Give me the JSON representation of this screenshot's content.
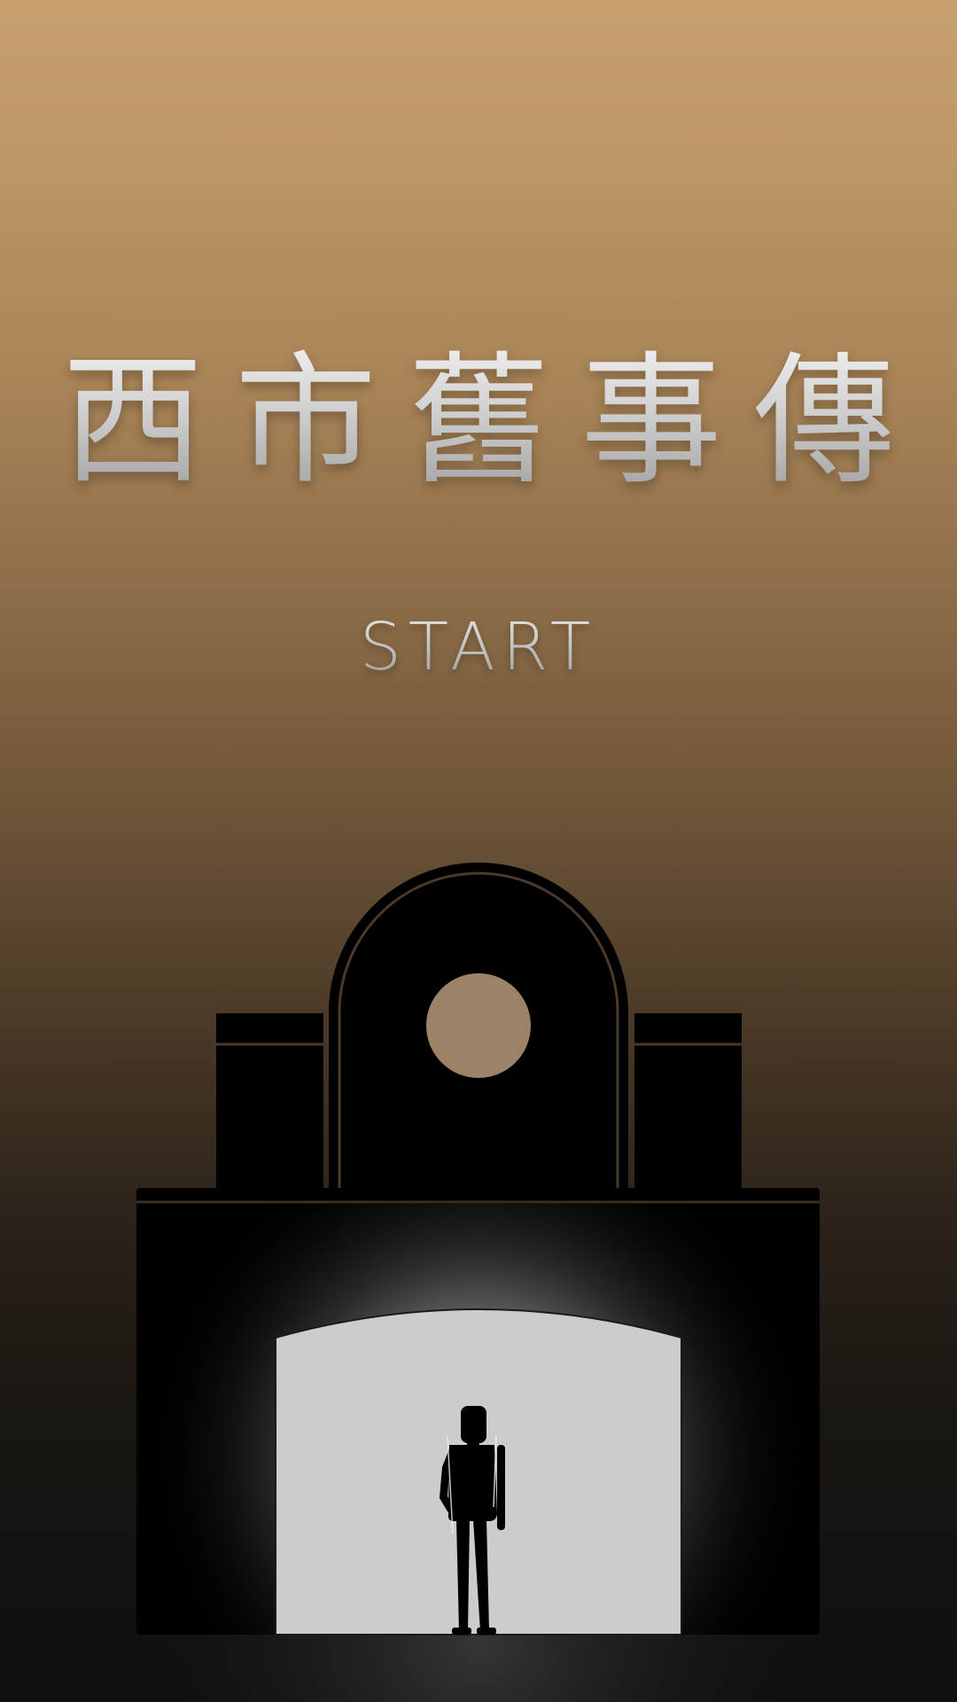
{
  "title": {
    "characters": [
      "西",
      "市",
      "舊",
      "事",
      "傳"
    ]
  },
  "menu": {
    "start_label": "START"
  },
  "scene": {
    "background_top": "#c89f6f",
    "background_bottom": "#0f0f0f",
    "building_color": "#000000",
    "trim_color": "#4a3a2c",
    "window_color": "#9c8368",
    "doorway_color": "#cccccc"
  }
}
